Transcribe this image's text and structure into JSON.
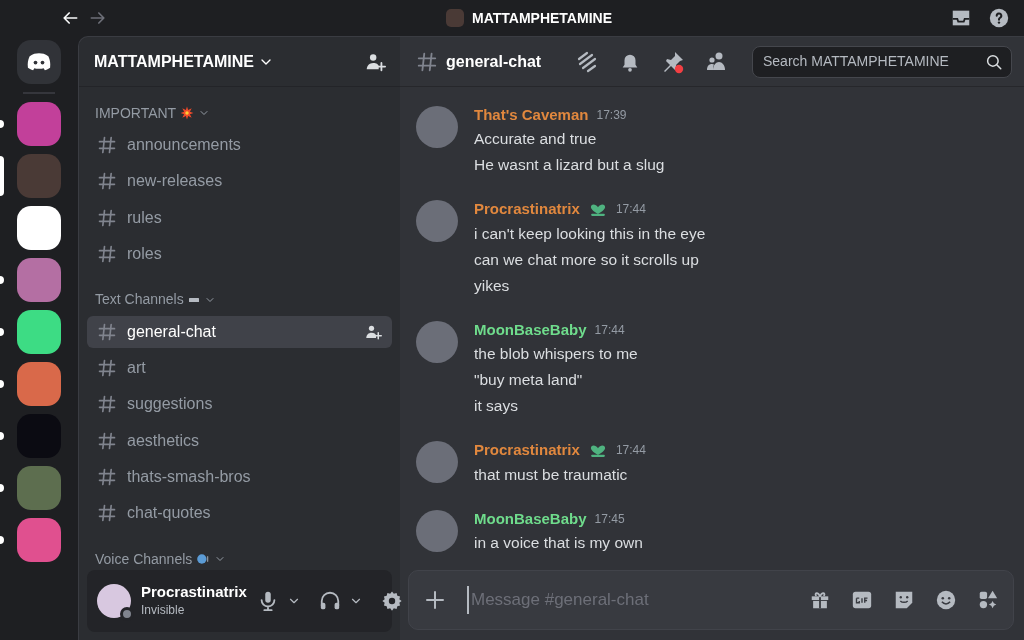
{
  "titlebar": {
    "server_name": "MATTAMPHETAMINE"
  },
  "servers": [
    {
      "selected": false,
      "unread": false,
      "kind": "home"
    },
    {
      "color": "#c2409a",
      "selected": false,
      "unread": true,
      "kind": "photo"
    },
    {
      "color": "#4a3a36",
      "selected": true,
      "unread": false,
      "kind": "photo"
    },
    {
      "color": "#ffffff",
      "selected": false,
      "unread": false,
      "kind": "photo"
    },
    {
      "color": "#b46fa3",
      "selected": false,
      "unread": true,
      "kind": "photo"
    },
    {
      "color": "#3ddc84",
      "selected": false,
      "unread": true,
      "kind": "photo"
    },
    {
      "color": "#d9694a",
      "selected": false,
      "unread": true,
      "kind": "photo"
    },
    {
      "color": "#0b0b12",
      "selected": false,
      "unread": true,
      "kind": "photo"
    },
    {
      "color": "#5d6e4f",
      "selected": false,
      "unread": true,
      "kind": "photo"
    },
    {
      "color": "#e0508f",
      "selected": false,
      "unread": true,
      "kind": "photo"
    }
  ],
  "sidebar": {
    "server_name": "MATTAMPHETAMINE",
    "categories": [
      {
        "name": "IMPORTANT",
        "kind": "important",
        "channels": [
          {
            "name": "announcements",
            "selected": false
          },
          {
            "name": "new-releases",
            "selected": false
          },
          {
            "name": "rules",
            "selected": false
          },
          {
            "name": "roles",
            "selected": false
          }
        ]
      },
      {
        "name": "Text Channels",
        "kind": "text",
        "channels": [
          {
            "name": "general-chat",
            "selected": true
          },
          {
            "name": "art",
            "selected": false
          },
          {
            "name": "suggestions",
            "selected": false
          },
          {
            "name": "aesthetics",
            "selected": false
          },
          {
            "name": "thats-smash-bros",
            "selected": false
          },
          {
            "name": "chat-quotes",
            "selected": false
          }
        ]
      },
      {
        "name": "Voice Channels",
        "kind": "voice"
      }
    ]
  },
  "user_panel": {
    "name": "Procrastinatrix",
    "status": "Invisible"
  },
  "chat_header": {
    "channel": "general-chat",
    "search": {
      "placeholder": "Search MATTAMPHETAMINE"
    }
  },
  "messages": [
    {
      "author": "That's Caveman",
      "color": "#e1883e",
      "time": "17:39",
      "lines": [
        "Accurate and true",
        "He wasnt a lizard but a slug"
      ]
    },
    {
      "author": "Procrastinatrix",
      "color": "#e1883e",
      "badge": true,
      "time": "17:44",
      "lines": [
        "i can't keep looking this in the eye",
        "can we chat more so it scrolls up",
        "yikes"
      ]
    },
    {
      "author": "MoonBaseBaby",
      "color": "#6fdc8c",
      "time": "17:44",
      "lines": [
        "the blob whispers to me",
        "\"buy meta land\"",
        "it says"
      ]
    },
    {
      "author": "Procrastinatrix",
      "color": "#e1883e",
      "badge": true,
      "time": "17:44",
      "lines": [
        "that must be traumatic"
      ]
    },
    {
      "author": "MoonBaseBaby",
      "color": "#6fdc8c",
      "time": "17:45",
      "lines": [
        "in a voice that is my own"
      ]
    }
  ],
  "composer": {
    "placeholder": "Message #general-chat"
  }
}
